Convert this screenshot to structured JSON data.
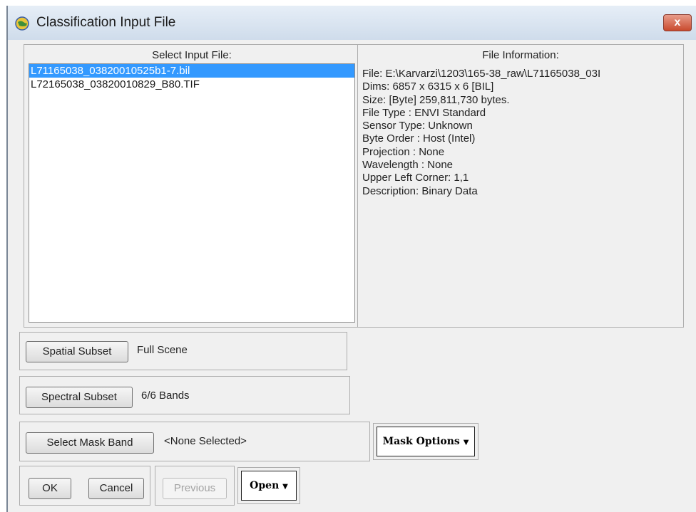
{
  "window": {
    "title": "Classification Input File",
    "close_label": "x"
  },
  "input_file_panel": {
    "header": "Select Input File:",
    "files": [
      "L71165038_03820010525b1-7.bil",
      "L72165038_03820010829_B80.TIF"
    ],
    "selected_index": 0
  },
  "file_info_panel": {
    "header": "File Information:",
    "lines": [
      "File: E:\\Karvarzi\\1203\\165-38_raw\\L71165038_03I",
      "Dims: 6857 x 6315 x 6 [BIL]",
      "Size: [Byte] 259,811,730 bytes.",
      "File Type  : ENVI Standard",
      "Sensor Type: Unknown",
      "Byte Order : Host (Intel)",
      "Projection : None",
      "Wavelength : None",
      "Upper Left Corner: 1,1",
      "Description: Binary Data"
    ]
  },
  "spatial_subset": {
    "button": "Spatial Subset",
    "value": "Full Scene"
  },
  "spectral_subset": {
    "button": "Spectral Subset",
    "value": "6/6 Bands"
  },
  "mask_band": {
    "button": "Select Mask Band",
    "value": "<None Selected>",
    "options_button": "Mask Options"
  },
  "actions": {
    "ok": "OK",
    "cancel": "Cancel",
    "previous": "Previous",
    "open": "Open"
  },
  "colors": {
    "selection": "#3399ff",
    "close_button": "#c94a2e"
  }
}
